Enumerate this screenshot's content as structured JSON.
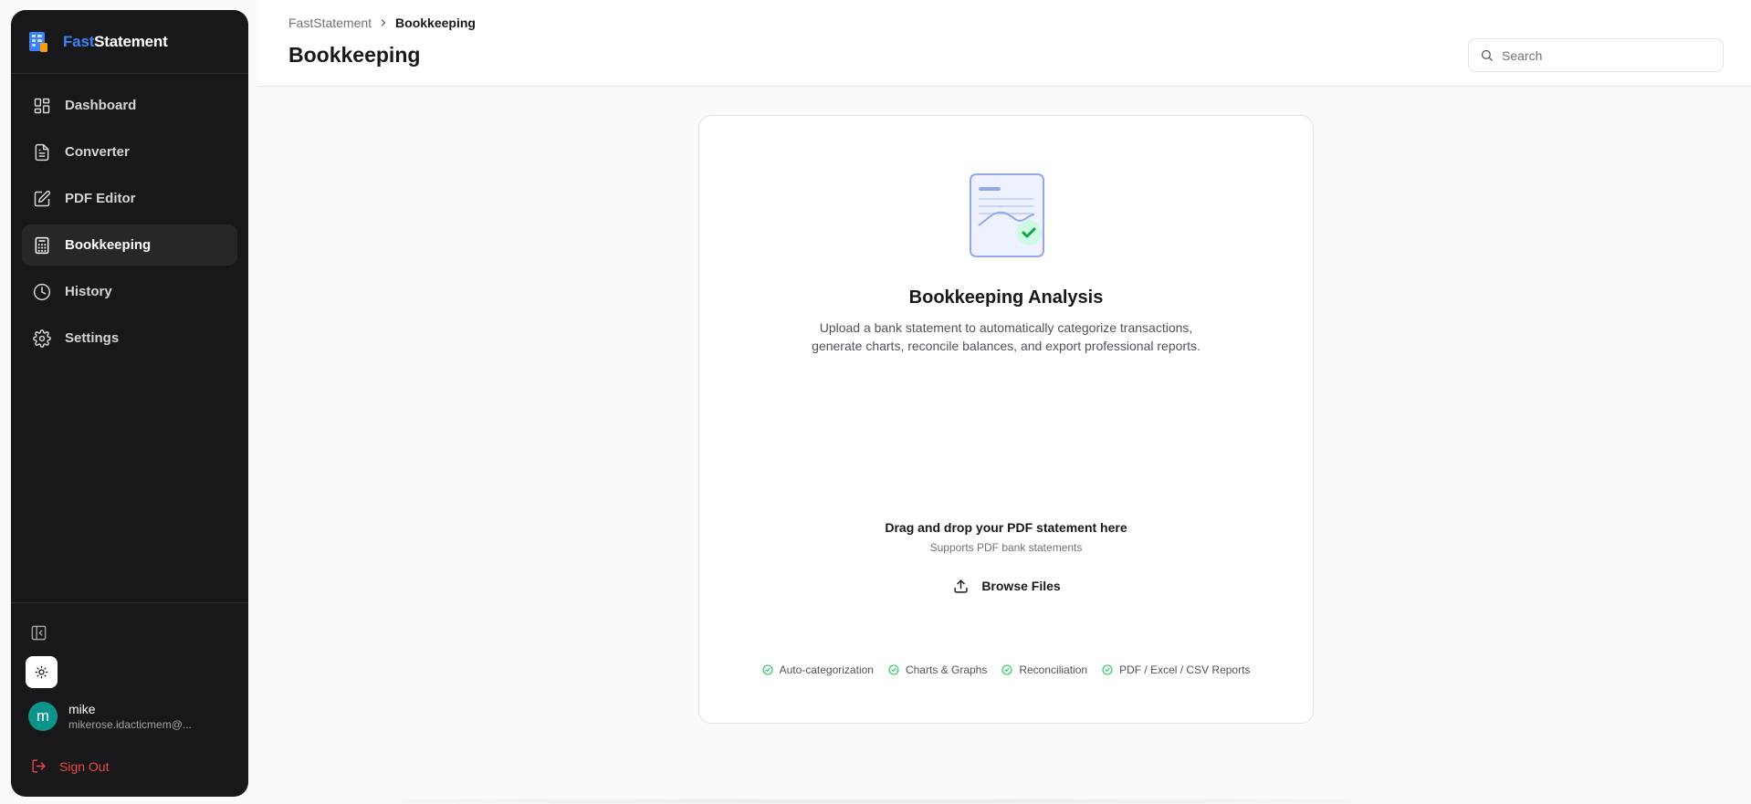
{
  "brand": {
    "name_part1": "Fast",
    "name_part2": "Statement",
    "accent": "#3b82f6"
  },
  "sidebar": {
    "items": [
      {
        "label": "Dashboard",
        "icon": "dashboard-grid-icon",
        "active": false
      },
      {
        "label": "Converter",
        "icon": "file-text-icon",
        "active": false
      },
      {
        "label": "PDF Editor",
        "icon": "edit-icon",
        "active": false
      },
      {
        "label": "Bookkeeping",
        "icon": "calculator-icon",
        "active": true
      },
      {
        "label": "History",
        "icon": "clock-icon",
        "active": false
      },
      {
        "label": "Settings",
        "icon": "gear-icon",
        "active": false
      }
    ],
    "user": {
      "initial": "m",
      "name": "mike",
      "email": "mikerose.idacticmem@..."
    },
    "signout_label": "Sign Out"
  },
  "header": {
    "breadcrumb": {
      "root": "FastStatement",
      "current": "Bookkeeping"
    },
    "title": "Bookkeeping",
    "search_placeholder": "Search"
  },
  "card": {
    "title": "Bookkeeping Analysis",
    "desc_line1": "Upload a bank statement to automatically categorize transactions,",
    "desc_line2": "generate charts, reconcile balances, and export professional reports.",
    "drop_title": "Drag and drop your PDF statement here",
    "drop_sub": "Supports PDF bank statements",
    "browse_label": "Browse Files",
    "features": [
      "Auto-categorization",
      "Charts & Graphs",
      "Reconciliation",
      "PDF / Excel / CSV Reports"
    ]
  },
  "colors": {
    "sidebar_bg": "#18181b",
    "danger": "#ef4444",
    "success": "#22c55e",
    "avatar": "#0d9488"
  }
}
